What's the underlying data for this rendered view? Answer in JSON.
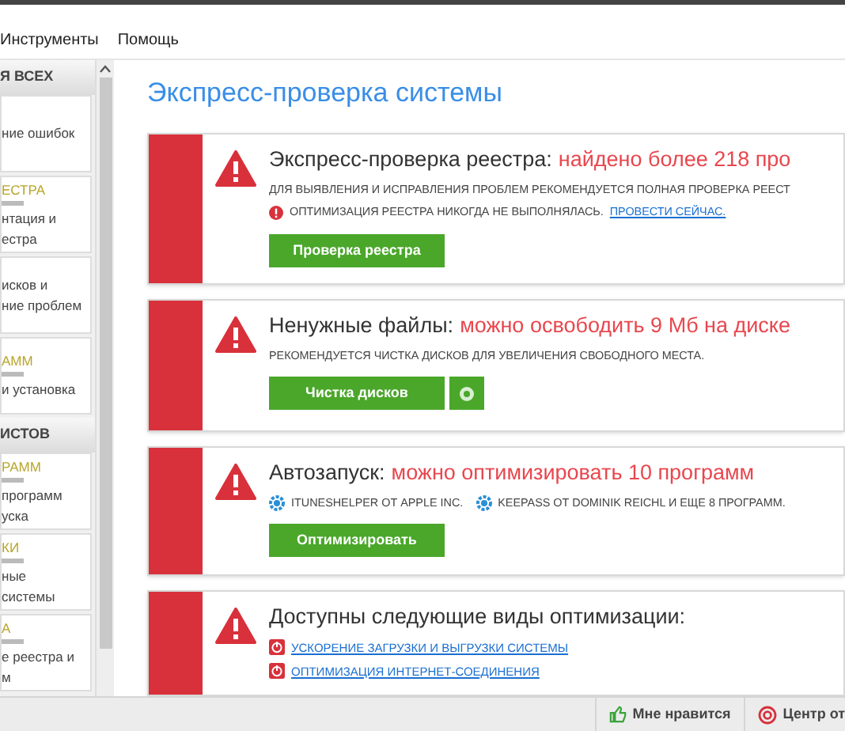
{
  "menu": [
    "Инструменты",
    "Помощь"
  ],
  "sidebar": [
    {
      "header": "Я ВСЕХ",
      "items": [
        {
          "lines": [
            "ние ошибок"
          ]
        },
        {
          "title": "ЕСТРА",
          "lines": [
            "нтация и",
            "естра"
          ]
        },
        {
          "lines": [
            "исков и",
            "ние проблем"
          ]
        },
        {
          "title": "АММ",
          "lines": [
            "и установка"
          ]
        }
      ]
    },
    {
      "header": "ИСТОВ",
      "items": [
        {
          "title": "РАММ",
          "lines": [
            "программ",
            "уска"
          ]
        },
        {
          "title": "КИ",
          "lines": [
            "ные",
            "системы"
          ]
        },
        {
          "title": "А",
          "lines": [
            "е реестра и",
            "м"
          ]
        }
      ]
    }
  ],
  "page_title": "Экспресс-проверка системы",
  "cards": [
    {
      "heading": "Экспресс-проверка реестра:",
      "highlight": "найдено более 218 про",
      "lines": [
        {
          "kind": "text",
          "text": "ДЛЯ ВЫЯВЛЕНИЯ И ИСПРАВЛЕНИЯ ПРОБЛЕМ РЕКОМЕНДУЕТСЯ ПОЛНАЯ ПРОВЕРКА РЕЕСТ"
        },
        {
          "kind": "alert",
          "text": "ОПТИМИЗАЦИЯ РЕЕСТРА НИКОГДА НЕ ВЫПОЛНЯЛАСЬ.",
          "link": "ПРОВЕСТИ СЕЙЧАС."
        }
      ],
      "button": "Проверка реестра",
      "extra_button": false
    },
    {
      "heading": "Ненужные файлы:",
      "highlight": "можно освободить 9 Мб на диске",
      "lines": [
        {
          "kind": "text",
          "text": "РЕКОМЕНДУЕТСЯ ЧИСТКА ДИСКОВ ДЛЯ УВЕЛИЧЕНИЯ СВОБОДНОГО МЕСТА."
        }
      ],
      "button": "Чистка дисков",
      "extra_button": true
    },
    {
      "heading": "Автозапуск:",
      "highlight": "можно оптимизировать 10 программ",
      "lines": [
        {
          "kind": "apps",
          "items": [
            "ITUNESHELPER ОТ APPLE INC.",
            "KEEPASS ОТ DOMINIK REICHL И ЕЩЕ 8 ПРОГРАММ."
          ]
        }
      ],
      "button": "Оптимизировать",
      "extra_button": false
    },
    {
      "heading": "Доступны следующие виды оптимизации:",
      "lines": [
        {
          "kind": "option",
          "text": "УСКОРЕНИЕ ЗАГРУЗКИ И ВЫГРУЗКИ СИСТЕМЫ"
        },
        {
          "kind": "option",
          "text": "ОПТИМИЗАЦИЯ ИНТЕРНЕТ-СОЕДИНЕНИЯ"
        }
      ]
    }
  ],
  "status_bar": [
    "Мне нравится",
    "Центр от"
  ]
}
